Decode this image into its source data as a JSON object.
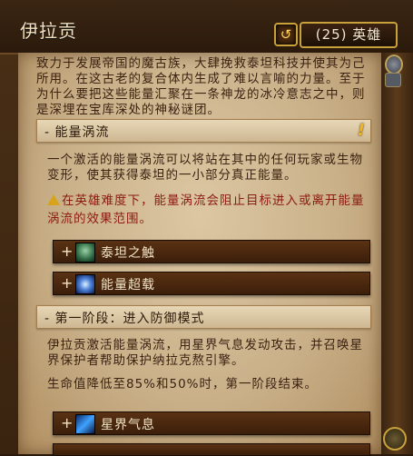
{
  "header": {
    "title": "伊拉贡",
    "back_icon": "undo-arrow-icon",
    "difficulty": "(25) 英雄"
  },
  "intro": "致力于发展帝国的魔古族，大肆挽救泰坦科技并使其为己所用。在这古老的复合体内生成了难以言喻的力量。至于为什么要把这些能量汇聚在一条神龙的冰冷意志之中，则是深埋在宝库深处的神秘谜团。",
  "sections": [
    {
      "header": "- 能量涡流",
      "body": "一个激活的能量涡流可以将站在其中的任何玩家或生物变形，使其获得泰坦的一小部分真正能量。",
      "warning": "在英雄难度下，能量涡流会阻止目标进入或离开能量涡流的效果范围。",
      "abilities": [
        {
          "plus": "+",
          "name": "泰坦之触",
          "icon": "titan-touch-icon"
        },
        {
          "plus": "+",
          "name": "能量超载",
          "icon": "energy-overload-icon"
        }
      ]
    },
    {
      "header": "- 第一阶段：进入防御模式",
      "body": "伊拉贡激活能量涡流，用星界气息发动攻击，并召唤星界保护者帮助保护纳拉克熬引擎。",
      "body2": "生命值降低至85%和50%时，第一阶段结束。",
      "abilities": [
        {
          "plus": "+",
          "name": "星界气息",
          "icon": "celestial-breath-icon"
        }
      ]
    }
  ],
  "colors": {
    "parchment": "#d2bb93",
    "text": "#3b2211",
    "warning": "#8b1a10",
    "gold_border": "#c8a13a"
  }
}
